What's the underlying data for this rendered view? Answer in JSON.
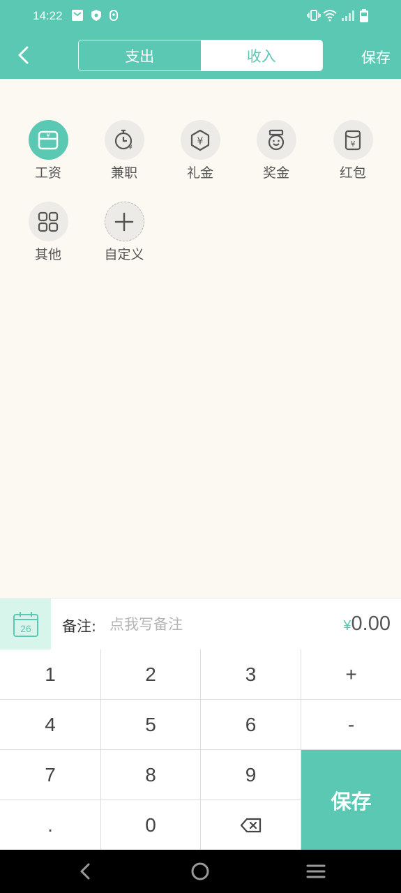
{
  "status_bar": {
    "time": "14:22"
  },
  "header": {
    "tabs": [
      {
        "label": "支出",
        "active": false
      },
      {
        "label": "收入",
        "active": true
      }
    ],
    "save_label": "保存"
  },
  "categories": [
    {
      "label": "工资",
      "icon": "wallet-icon",
      "active": true
    },
    {
      "label": "兼职",
      "icon": "clock-yen-icon",
      "active": false
    },
    {
      "label": "礼金",
      "icon": "yen-hexagon-icon",
      "active": false
    },
    {
      "label": "奖金",
      "icon": "medal-icon",
      "active": false
    },
    {
      "label": "红包",
      "icon": "red-envelope-icon",
      "active": false
    },
    {
      "label": "其他",
      "icon": "grid-icon",
      "active": false
    },
    {
      "label": "自定义",
      "icon": "plus-icon",
      "active": false
    }
  ],
  "note": {
    "calendar_day": "26",
    "label": "备注:",
    "placeholder": "点我写备注",
    "currency": "¥",
    "amount": "0.00"
  },
  "keypad": {
    "k1": "1",
    "k2": "2",
    "k3": "3",
    "plus": "+",
    "k4": "4",
    "k5": "5",
    "k6": "6",
    "minus": "-",
    "k7": "7",
    "k8": "8",
    "k9": "9",
    "dot": ".",
    "k0": "0",
    "save": "保存"
  },
  "colors": {
    "accent": "#5bc8b3",
    "background": "#fbf9f1",
    "navbar": "#000000"
  }
}
